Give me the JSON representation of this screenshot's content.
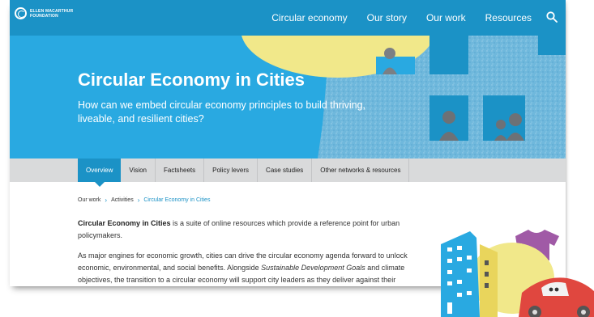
{
  "logo": {
    "line1": "ELLEN MACARTHUR",
    "line2": "FOUNDATION"
  },
  "nav": [
    {
      "label": "Circular economy"
    },
    {
      "label": "Our story"
    },
    {
      "label": "Our work"
    },
    {
      "label": "Resources"
    }
  ],
  "hero": {
    "title": "Circular Economy in Cities",
    "subtitle": "How can we embed circular economy principles to build thriving, liveable, and resilient cities?"
  },
  "tabs": [
    {
      "label": "Overview",
      "active": true
    },
    {
      "label": "Vision"
    },
    {
      "label": "Factsheets"
    },
    {
      "label": "Policy levers"
    },
    {
      "label": "Case studies"
    },
    {
      "label": "Other networks & resources"
    }
  ],
  "breadcrumb": {
    "item1": "Our work",
    "item2": "Activities",
    "current": "Circular Economy in Cities",
    "separator": "›"
  },
  "content": {
    "p1_bold": "Circular Economy in Cities",
    "p1_rest": " is a suite of online resources which provide a reference point for urban policymakers.",
    "p2_start": "As major engines for economic growth, cities can drive the circular economy agenda forward to unlock economic, environmental, and social benefits. Alongside ",
    "p2_italic": "Sustainable Development Goals",
    "p2_end": " and climate objectives, the transition to a circular economy will support city leaders as they deliver against their priorities,"
  },
  "colors": {
    "nav_blue": "#1b92c6",
    "hero_blue": "#29a9e1",
    "tab_bar": "#d9dadb",
    "yellow": "#f1e88a"
  },
  "icons": {
    "search": "search-icon",
    "logo": "logo-circle-icon"
  }
}
